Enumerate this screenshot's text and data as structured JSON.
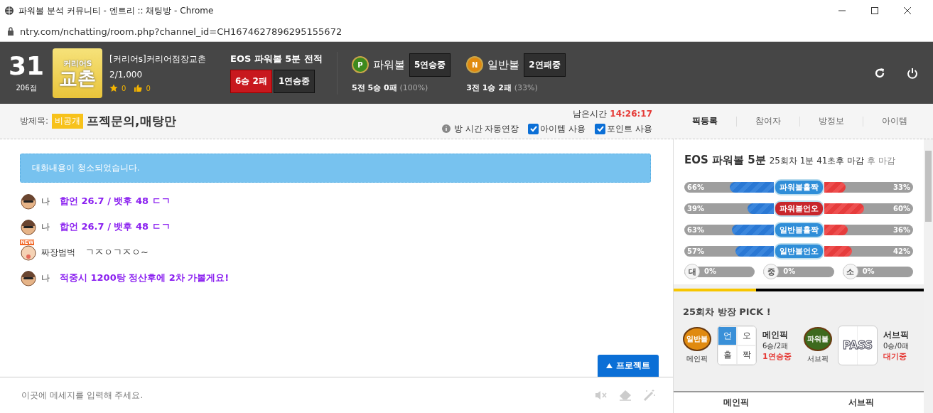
{
  "window": {
    "title": "파워볼 분석 커뮤니티 - 엔트리 :: 채팅방 - Chrome",
    "url": "ntry.com/nchatting/room.php?channel_id=CH1674627896295155672"
  },
  "header": {
    "rank": "31",
    "points": "206점",
    "logo_top": "커리어S",
    "logo_main": "교촌",
    "room_name": "[커리어s]커리어점장교촌",
    "members": "2/1,000",
    "stars": "0",
    "likes": "0",
    "record": {
      "title": "EOS 파워볼 5분 전적",
      "result": "6승 2패",
      "streak": "1연승중"
    },
    "balls": [
      {
        "kind": "powerball",
        "letter": "P",
        "name": "파워볼",
        "streak": "5연승중",
        "games": "5전",
        "wins": "5승",
        "losses": "0패",
        "rate": "(100%)"
      },
      {
        "kind": "normal",
        "letter": "N",
        "name": "일반볼",
        "streak": "2연패중",
        "games": "3전",
        "wins": "1승",
        "losses": "2패",
        "rate": "(33%)"
      }
    ]
  },
  "room": {
    "title_label": "방제목:",
    "privacy": "비공개",
    "title": "프젝문의,매탕만",
    "remaining_label": "남은시간",
    "remaining": "14:26:17",
    "auto_extend": "방 시간 자동연장",
    "options": [
      {
        "label": "아이템 사용",
        "checked": true
      },
      {
        "label": "포인트 사용",
        "checked": true
      }
    ],
    "tabs": [
      {
        "label": "픽등록",
        "selected": true
      },
      {
        "label": "참여자",
        "selected": false
      },
      {
        "label": "방정보",
        "selected": false
      },
      {
        "label": "아이템",
        "selected": false
      }
    ]
  },
  "chat": {
    "notice": "대화내용이 청소되었습니다.",
    "messages": [
      {
        "kind": "self",
        "name": "나",
        "text": "합언 26.7 / 뱃후 48 ㄷㄱ"
      },
      {
        "kind": "self",
        "name": "나",
        "text": "합언 26.7 / 뱃후 48 ㄷㄱ"
      },
      {
        "kind": "other",
        "new_badge": "NEW",
        "name": "짜장범벅",
        "text": "ㄱㅈㅇㄱㅈㅇ~"
      },
      {
        "kind": "self",
        "name": "나",
        "text": "적중시 1200탕 정산후에 2차 가볼게요!"
      }
    ],
    "project_button": "프로젝트",
    "input": {
      "placeholder": "이곳에 메세지를 입력해 주세요."
    }
  },
  "panel": {
    "game": "EOS 파워볼 5분",
    "round": "25회차",
    "countdown": "1분 41초후 마감",
    "after": "후 마감",
    "bars": [
      {
        "label": "파워볼홀짝",
        "color": "#2f8ed8",
        "left": {
          "text": "66%",
          "level": 0.66
        },
        "right": {
          "text": "33%",
          "level": 0.33
        }
      },
      {
        "label": "파워볼언오",
        "color": "#c8262c",
        "left": {
          "text": "39%",
          "level": 0.39
        },
        "right": {
          "text": "60%",
          "level": 0.6
        }
      },
      {
        "label": "일반볼홀짝",
        "color": "#2f8ed8",
        "left": {
          "text": "63%",
          "level": 0.63
        },
        "right": {
          "text": "36%",
          "level": 0.36
        }
      },
      {
        "label": "일반볼언오",
        "color": "#2f8ed8",
        "left": {
          "text": "57%",
          "level": 0.57
        },
        "right": {
          "text": "42%",
          "level": 0.42
        }
      }
    ],
    "sizes": [
      {
        "label": "대",
        "value": "0%"
      },
      {
        "label": "중",
        "value": "0%"
      },
      {
        "label": "소",
        "value": "0%"
      }
    ],
    "pick_title": "25회차 방장 PICK !",
    "picks": [
      {
        "kind": "main",
        "ball": "일반볼",
        "ball_caption": "메인픽",
        "pass": false,
        "cells": [
          {
            "label": "언",
            "selected": true
          },
          {
            "label": "오",
            "selected": false
          },
          {
            "label": "홀",
            "selected": false
          },
          {
            "label": "짝",
            "selected": false
          }
        ],
        "title": "메인픽",
        "record": "6승/2패",
        "status": "1연승중"
      },
      {
        "kind": "sub",
        "ball": "파워볼",
        "ball_caption": "서브픽",
        "pass": true,
        "pass_label": "PASS",
        "title": "서브픽",
        "record": "0승/0패",
        "status": "대기중"
      }
    ],
    "bottom_tabs": [
      "메인픽",
      "서브픽"
    ]
  }
}
